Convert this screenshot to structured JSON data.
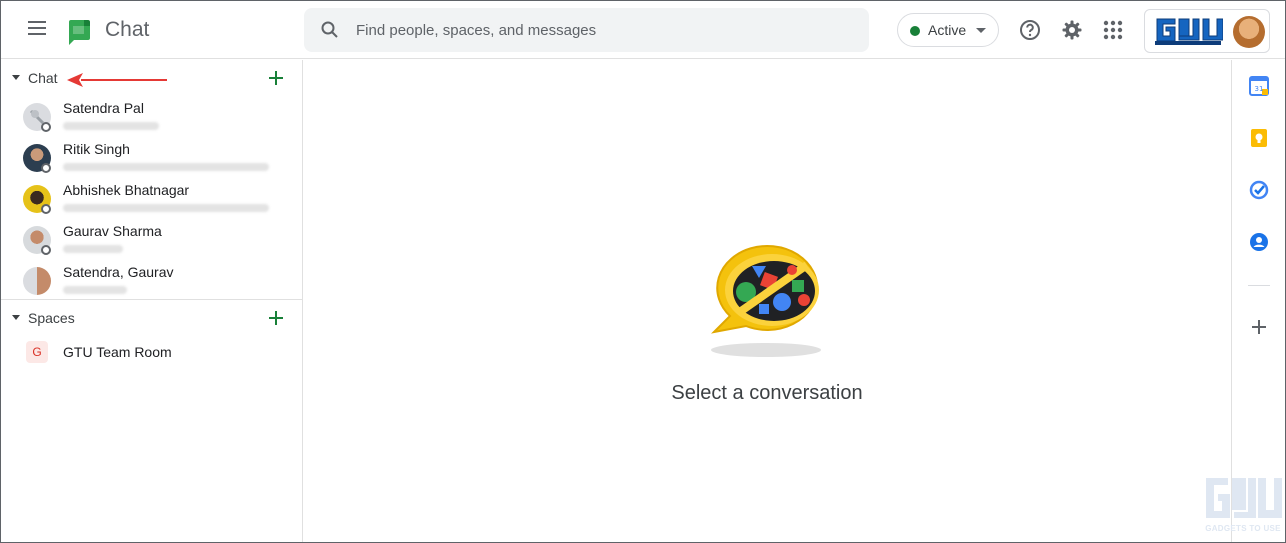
{
  "header": {
    "app_title": "Chat",
    "search_placeholder": "Find people, spaces, and messages",
    "status_label": "Active",
    "status_color": "#188038",
    "icons": [
      "menu-icon",
      "chat-logo-icon",
      "search-icon",
      "help-icon",
      "settings-icon",
      "apps-grid-icon",
      "account-avatar"
    ],
    "brand_logo_text": "GADGETS TO USE"
  },
  "sidebar": {
    "chat_section": {
      "label": "Chat",
      "items": [
        {
          "name": "Satendra Pal"
        },
        {
          "name": "Ritik Singh"
        },
        {
          "name": "Abhishek Bhatnagar"
        },
        {
          "name": "Gaurav Sharma"
        },
        {
          "name": "Satendra, Gaurav"
        }
      ]
    },
    "spaces_section": {
      "label": "Spaces",
      "items": [
        {
          "initial": "G",
          "name": "GTU Team Room"
        }
      ]
    }
  },
  "main": {
    "empty_state_text": "Select a conversation"
  },
  "side_panel": {
    "icons": [
      "calendar-icon",
      "keep-icon",
      "tasks-icon",
      "contacts-icon",
      "add-icon"
    ]
  },
  "watermark": {
    "text": "GADGETS TO USE"
  },
  "colors": {
    "accent_green": "#188038",
    "annotation_arrow": "#e53935"
  }
}
